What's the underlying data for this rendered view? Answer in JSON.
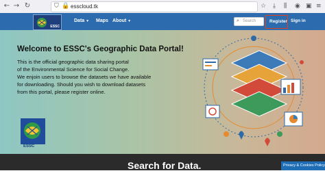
{
  "browser": {
    "url": "esscloud.tk"
  },
  "navbar": {
    "logo_text": "ESSC",
    "links": [
      {
        "label": "Data",
        "has_dropdown": true
      },
      {
        "label": "Maps",
        "has_dropdown": false
      },
      {
        "label": "About",
        "has_dropdown": true
      }
    ],
    "search_placeholder": "Search",
    "register_label": "Register",
    "signin_label": "Sign in",
    "background_color": "#2c6cae",
    "highlight_color": "#e0401f"
  },
  "hero": {
    "title": "Welcome to ESSC's Geographic Data Portal!",
    "lines": [
      "This is the official geographic data sharing portal",
      "of the Environmental Science for Social Change.",
      "We enjoin users to browse the datasets we have available",
      "for downloading. Should you wish to download datasets",
      "from this portal, please register online."
    ],
    "logo_text": "ESSC"
  },
  "lower": {
    "title": "Search for Data."
  },
  "privacy_button": "Privacy & Cookies Policy",
  "icons": [
    "back-arrow-icon",
    "forward-arrow-icon",
    "reload-icon",
    "shield-icon",
    "lock-icon",
    "bookmark-star-icon",
    "menu-icon",
    "search-icon",
    "chevron-down-icon"
  ]
}
